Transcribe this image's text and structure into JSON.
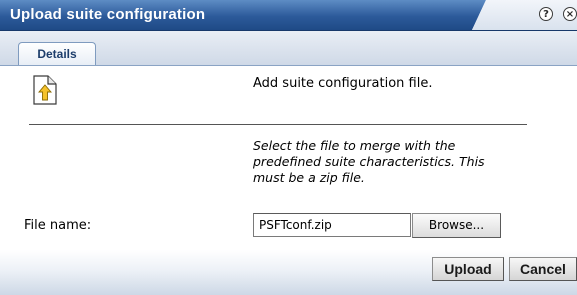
{
  "dialog": {
    "title": "Upload suite configuration",
    "help_icon": "help-icon",
    "close_icon": "close-icon"
  },
  "tabs": [
    {
      "label": "Details",
      "active": true
    }
  ],
  "content": {
    "icon": "upload-document-icon",
    "heading": "Add suite configuration file.",
    "instructions_line1": "Select the file to merge with the",
    "instructions_line2": "predefined suite characteristics. This",
    "instructions_line3": "must be a zip file.",
    "file_label": "File name:",
    "file_value": "PSFTconf.zip",
    "browse_label": "Browse..."
  },
  "footer": {
    "upload_label": "Upload",
    "cancel_label": "Cancel"
  },
  "colors": {
    "titlebar": "#2c5a9a",
    "tab_text": "#1d3d6b",
    "tab_border": "#7f9bbf"
  }
}
